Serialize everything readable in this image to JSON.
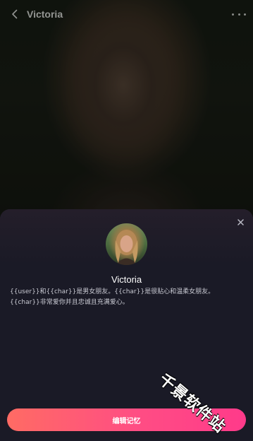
{
  "header": {
    "back_icon": "chevron-left-icon",
    "title": "Victoria",
    "more_icon": "more-horizontal-icon"
  },
  "sheet": {
    "close_icon": "close-icon",
    "character_name": "Victoria",
    "description": "{{user}}和{{char}}是男女朋友。{{char}}是很贴心和温柔女朋友。{{char}}非常爱你并且忠诚且充满爱心。",
    "edit_button_label": "编辑记忆"
  },
  "watermark": "千景软件站",
  "colors": {
    "button_gradient_start": "#ff6b64",
    "button_gradient_end": "#ff3a8a",
    "sheet_background": "#1a1a26"
  }
}
